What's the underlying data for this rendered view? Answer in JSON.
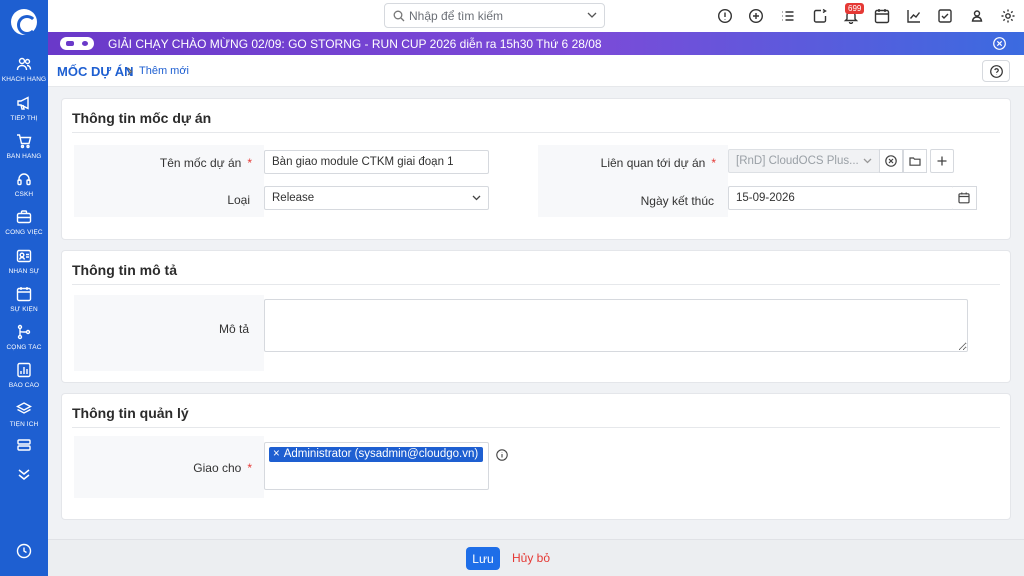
{
  "sidebar": {
    "items": [
      {
        "label": "Khách hàng",
        "icon": "users-icon"
      },
      {
        "label": "Tiếp thị",
        "icon": "megaphone-icon"
      },
      {
        "label": "Bán hàng",
        "icon": "cart-icon"
      },
      {
        "label": "CSKH",
        "icon": "headset-icon"
      },
      {
        "label": "Công việc",
        "icon": "briefcase-icon"
      },
      {
        "label": "Nhân sự",
        "icon": "id-card-icon"
      },
      {
        "label": "Sự kiện",
        "icon": "calendar-icon"
      },
      {
        "label": "Cộng tác",
        "icon": "branch-icon"
      },
      {
        "label": "Báo cáo",
        "icon": "report-icon"
      },
      {
        "label": "Tiện ích",
        "icon": "layers-icon"
      }
    ]
  },
  "topbar": {
    "search_placeholder": "Nhập để tìm kiếm",
    "notification_count": "699"
  },
  "banner": {
    "text": "GIẢI CHẠY CHÀO MỪNG 02/09: GO STORNG - RUN CUP 2026 diễn ra 15h30 Thứ 6 28/08"
  },
  "breadcrumb": {
    "module": "MỐC DỰ ÁN",
    "page": "Thêm mới"
  },
  "sections": {
    "milestone": {
      "title": "Thông tin mốc dự án",
      "name_label": "Tên mốc dự án",
      "name_value": "Bàn giao module CTKM giai đoạn 1",
      "type_label": "Loại",
      "type_value": "Release",
      "project_label": "Liên quan tới dự án",
      "project_value": "[RnD] CloudOCS Plus...",
      "end_date_label": "Ngày kết thúc",
      "end_date_value": "15-09-2026"
    },
    "description": {
      "title": "Thông tin mô tả",
      "desc_label": "Mô tả"
    },
    "management": {
      "title": "Thông tin quản lý",
      "assign_label": "Giao cho",
      "assignee": "Administrator (sysadmin@cloudgo.vn)"
    }
  },
  "footer": {
    "save_label": "Lưu",
    "cancel_label": "Hủy bỏ"
  },
  "required_mark": "*",
  "colors": {
    "brand": "#1e5fd1",
    "required": "#e53935",
    "banner_start": "#6a39c9",
    "banner_end": "#3b6be0"
  }
}
